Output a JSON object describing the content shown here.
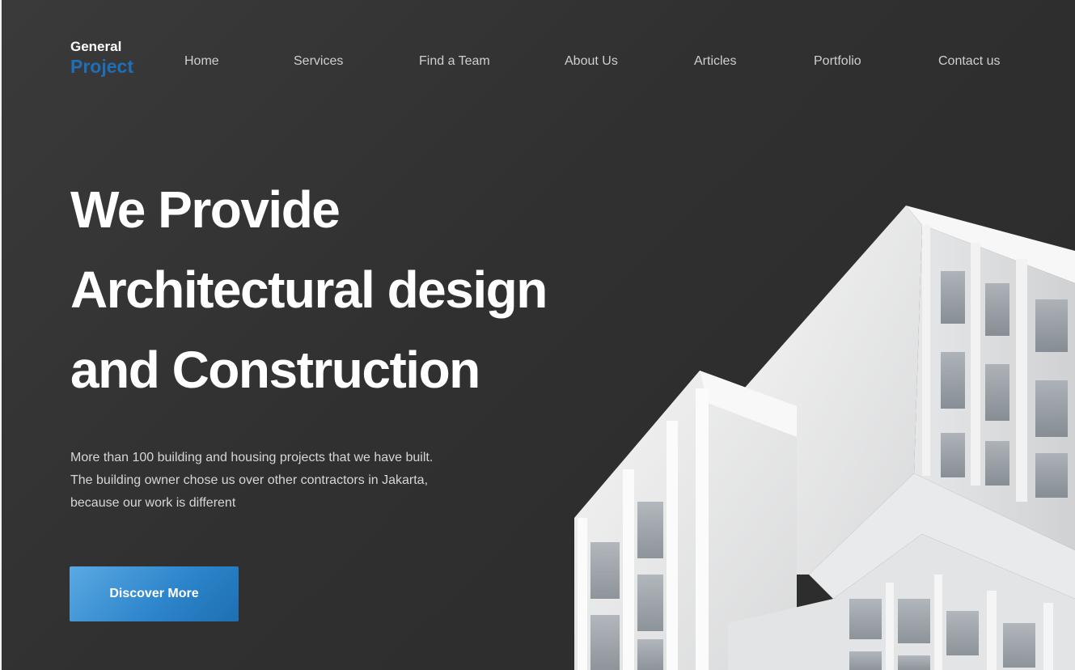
{
  "logo": {
    "top": "General",
    "bottom": "Project"
  },
  "nav": {
    "items": [
      {
        "label": "Home"
      },
      {
        "label": "Services"
      },
      {
        "label": "Find a Team"
      },
      {
        "label": "About Us"
      },
      {
        "label": "Articles"
      },
      {
        "label": "Portfolio"
      },
      {
        "label": "Contact us"
      }
    ]
  },
  "hero": {
    "title_lines": [
      "We Provide",
      "Architectural design",
      "and Construction"
    ],
    "description_lines": [
      "More than 100 building and housing projects that we have built.",
      "The building owner chose us over other contractors in Jakarta,",
      "because our work is different"
    ],
    "cta_label": "Discover More"
  },
  "colors": {
    "background": "#2e2e2e",
    "accent": "#1f6fb8",
    "button_gradient_start": "#5aa9e2",
    "button_gradient_end": "#1d6fb2"
  },
  "icons": {
    "hero_image": "white-modern-building-image"
  }
}
